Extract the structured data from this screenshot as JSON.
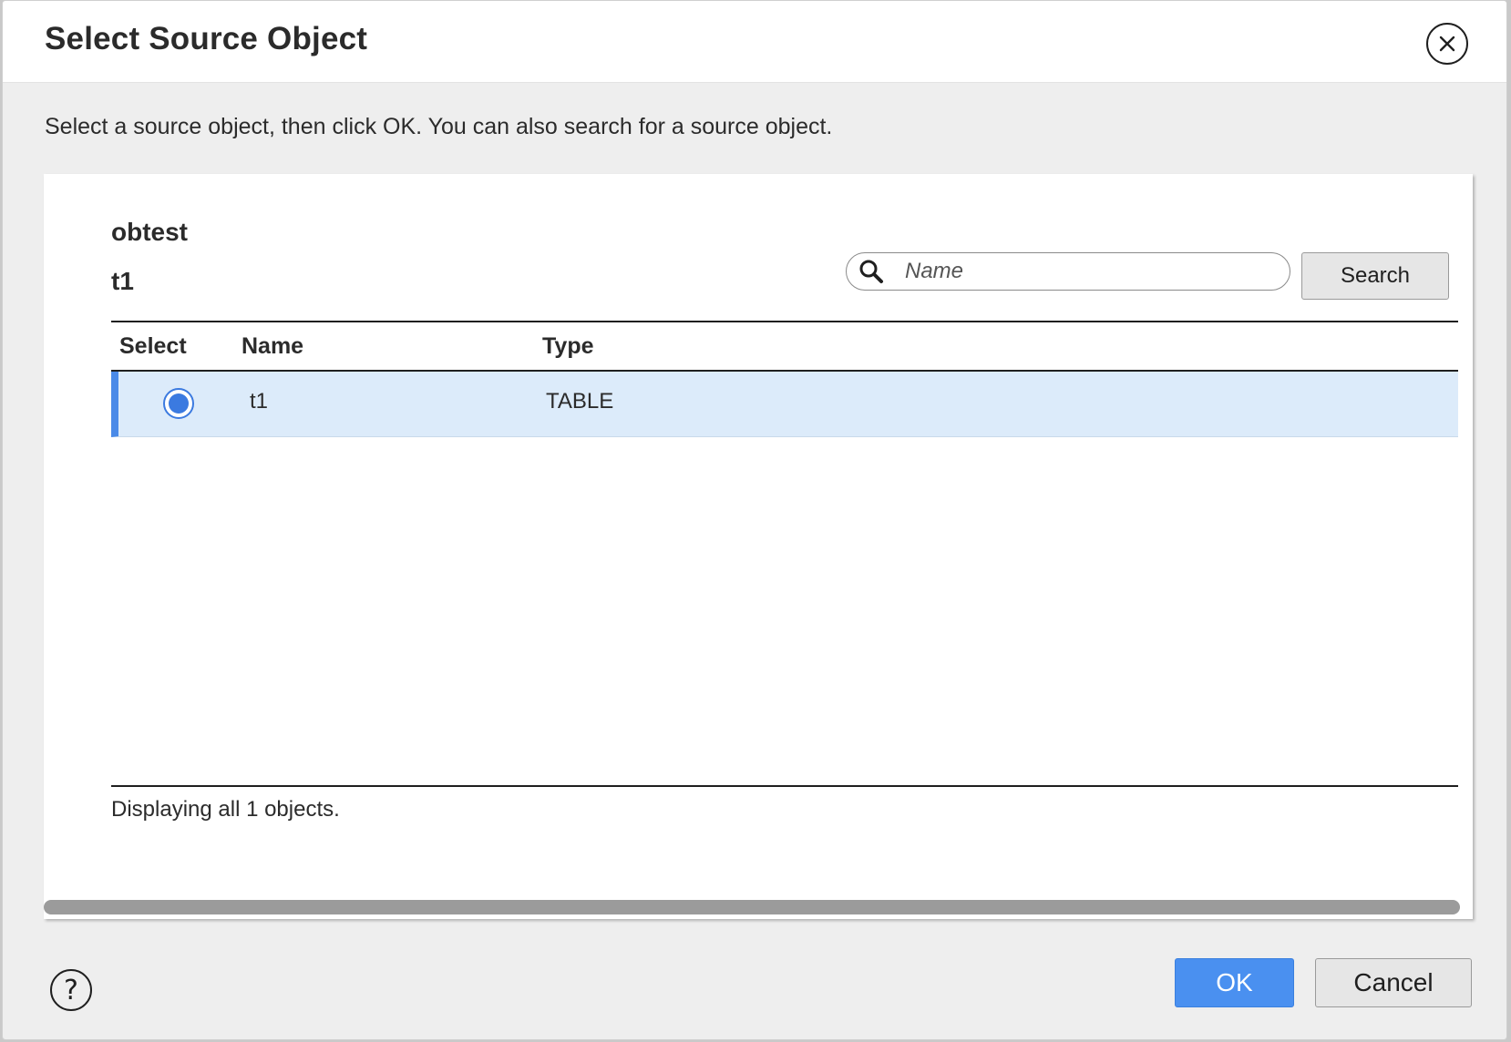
{
  "dialog": {
    "title": "Select Source Object",
    "instruction": "Select a source object, then click OK. You can also search for a source object."
  },
  "panel": {
    "connection_name": "obtest",
    "object_name": "t1",
    "search": {
      "placeholder": "Name",
      "button_label": "Search"
    },
    "table": {
      "headers": [
        "Select",
        "Name",
        "Type"
      ],
      "rows": [
        {
          "selected": true,
          "name": "t1",
          "type": "TABLE"
        }
      ]
    },
    "status": "Displaying all 1 objects."
  },
  "footer": {
    "help_glyph": "?",
    "ok_label": "OK",
    "cancel_label": "Cancel"
  },
  "icons": {
    "close": "close-icon",
    "search": "search-icon",
    "help": "help-icon"
  },
  "colors": {
    "accent": "#4a90f0",
    "selected_row": "#dcebfa",
    "selected_marker": "#4a8ae8"
  }
}
